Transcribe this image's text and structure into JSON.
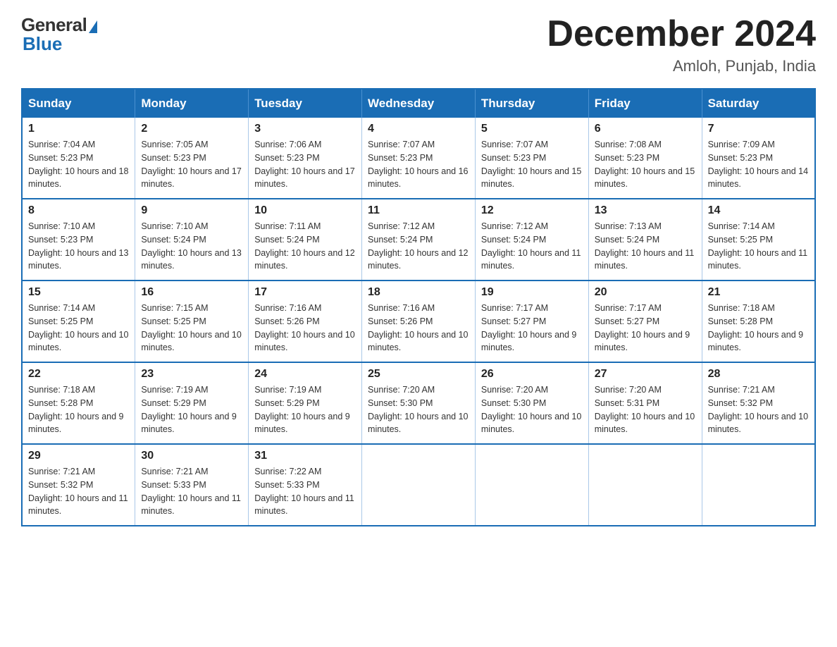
{
  "logo": {
    "general": "General",
    "blue": "Blue"
  },
  "title": {
    "month": "December 2024",
    "location": "Amloh, Punjab, India"
  },
  "headers": [
    "Sunday",
    "Monday",
    "Tuesday",
    "Wednesday",
    "Thursday",
    "Friday",
    "Saturday"
  ],
  "weeks": [
    [
      {
        "day": "1",
        "sunrise": "7:04 AM",
        "sunset": "5:23 PM",
        "daylight": "10 hours and 18 minutes."
      },
      {
        "day": "2",
        "sunrise": "7:05 AM",
        "sunset": "5:23 PM",
        "daylight": "10 hours and 17 minutes."
      },
      {
        "day": "3",
        "sunrise": "7:06 AM",
        "sunset": "5:23 PM",
        "daylight": "10 hours and 17 minutes."
      },
      {
        "day": "4",
        "sunrise": "7:07 AM",
        "sunset": "5:23 PM",
        "daylight": "10 hours and 16 minutes."
      },
      {
        "day": "5",
        "sunrise": "7:07 AM",
        "sunset": "5:23 PM",
        "daylight": "10 hours and 15 minutes."
      },
      {
        "day": "6",
        "sunrise": "7:08 AM",
        "sunset": "5:23 PM",
        "daylight": "10 hours and 15 minutes."
      },
      {
        "day": "7",
        "sunrise": "7:09 AM",
        "sunset": "5:23 PM",
        "daylight": "10 hours and 14 minutes."
      }
    ],
    [
      {
        "day": "8",
        "sunrise": "7:10 AM",
        "sunset": "5:23 PM",
        "daylight": "10 hours and 13 minutes."
      },
      {
        "day": "9",
        "sunrise": "7:10 AM",
        "sunset": "5:24 PM",
        "daylight": "10 hours and 13 minutes."
      },
      {
        "day": "10",
        "sunrise": "7:11 AM",
        "sunset": "5:24 PM",
        "daylight": "10 hours and 12 minutes."
      },
      {
        "day": "11",
        "sunrise": "7:12 AM",
        "sunset": "5:24 PM",
        "daylight": "10 hours and 12 minutes."
      },
      {
        "day": "12",
        "sunrise": "7:12 AM",
        "sunset": "5:24 PM",
        "daylight": "10 hours and 11 minutes."
      },
      {
        "day": "13",
        "sunrise": "7:13 AM",
        "sunset": "5:24 PM",
        "daylight": "10 hours and 11 minutes."
      },
      {
        "day": "14",
        "sunrise": "7:14 AM",
        "sunset": "5:25 PM",
        "daylight": "10 hours and 11 minutes."
      }
    ],
    [
      {
        "day": "15",
        "sunrise": "7:14 AM",
        "sunset": "5:25 PM",
        "daylight": "10 hours and 10 minutes."
      },
      {
        "day": "16",
        "sunrise": "7:15 AM",
        "sunset": "5:25 PM",
        "daylight": "10 hours and 10 minutes."
      },
      {
        "day": "17",
        "sunrise": "7:16 AM",
        "sunset": "5:26 PM",
        "daylight": "10 hours and 10 minutes."
      },
      {
        "day": "18",
        "sunrise": "7:16 AM",
        "sunset": "5:26 PM",
        "daylight": "10 hours and 10 minutes."
      },
      {
        "day": "19",
        "sunrise": "7:17 AM",
        "sunset": "5:27 PM",
        "daylight": "10 hours and 9 minutes."
      },
      {
        "day": "20",
        "sunrise": "7:17 AM",
        "sunset": "5:27 PM",
        "daylight": "10 hours and 9 minutes."
      },
      {
        "day": "21",
        "sunrise": "7:18 AM",
        "sunset": "5:28 PM",
        "daylight": "10 hours and 9 minutes."
      }
    ],
    [
      {
        "day": "22",
        "sunrise": "7:18 AM",
        "sunset": "5:28 PM",
        "daylight": "10 hours and 9 minutes."
      },
      {
        "day": "23",
        "sunrise": "7:19 AM",
        "sunset": "5:29 PM",
        "daylight": "10 hours and 9 minutes."
      },
      {
        "day": "24",
        "sunrise": "7:19 AM",
        "sunset": "5:29 PM",
        "daylight": "10 hours and 9 minutes."
      },
      {
        "day": "25",
        "sunrise": "7:20 AM",
        "sunset": "5:30 PM",
        "daylight": "10 hours and 10 minutes."
      },
      {
        "day": "26",
        "sunrise": "7:20 AM",
        "sunset": "5:30 PM",
        "daylight": "10 hours and 10 minutes."
      },
      {
        "day": "27",
        "sunrise": "7:20 AM",
        "sunset": "5:31 PM",
        "daylight": "10 hours and 10 minutes."
      },
      {
        "day": "28",
        "sunrise": "7:21 AM",
        "sunset": "5:32 PM",
        "daylight": "10 hours and 10 minutes."
      }
    ],
    [
      {
        "day": "29",
        "sunrise": "7:21 AM",
        "sunset": "5:32 PM",
        "daylight": "10 hours and 11 minutes."
      },
      {
        "day": "30",
        "sunrise": "7:21 AM",
        "sunset": "5:33 PM",
        "daylight": "10 hours and 11 minutes."
      },
      {
        "day": "31",
        "sunrise": "7:22 AM",
        "sunset": "5:33 PM",
        "daylight": "10 hours and 11 minutes."
      },
      null,
      null,
      null,
      null
    ]
  ]
}
